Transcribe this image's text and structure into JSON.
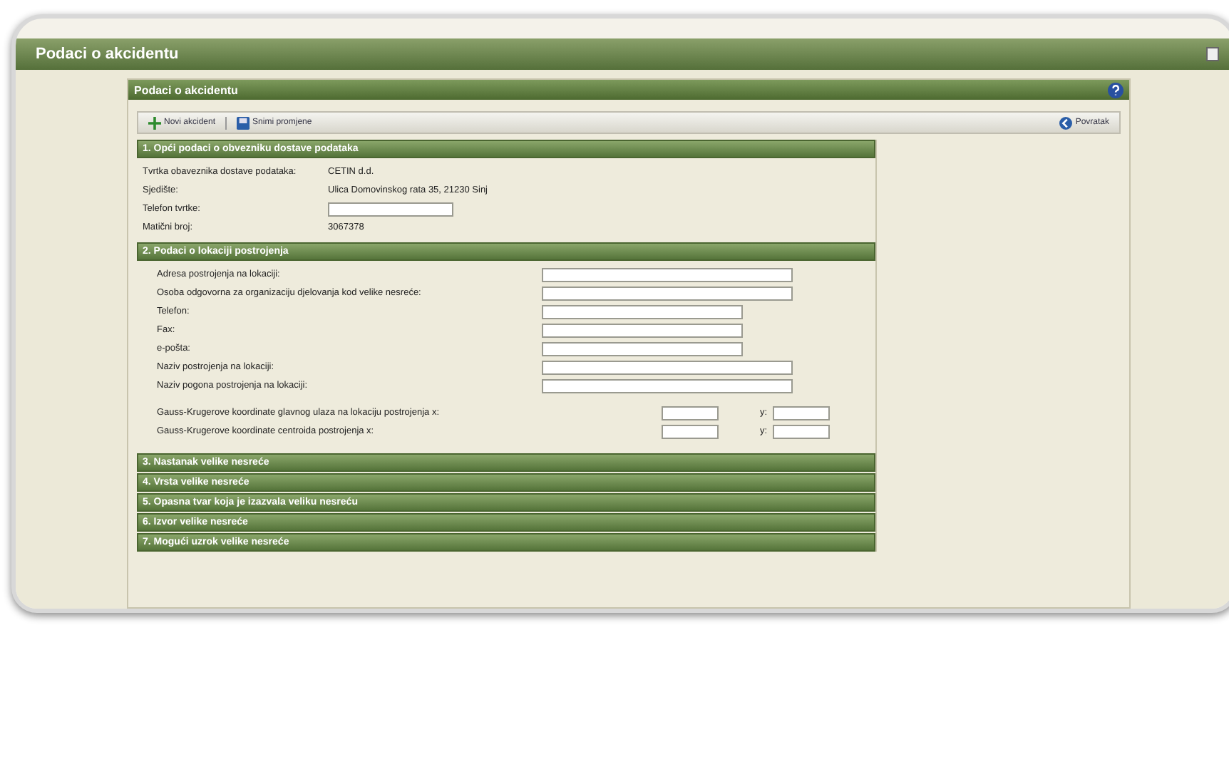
{
  "window": {
    "title": "Podaci o akcidentu"
  },
  "panel": {
    "title": "Podaci o akcidentu"
  },
  "toolbar": {
    "left": [
      {
        "label": "Novi akcident",
        "kind": "add"
      },
      {
        "label": "Snimi promjene",
        "kind": "save"
      }
    ],
    "right": {
      "label": "Povratak",
      "kind": "back"
    }
  },
  "section1": {
    "title": "1. Opći podaci o obvezniku dostave podataka",
    "rows": [
      {
        "label": "Tvrtka obaveznika dostave podataka:",
        "kind": "text",
        "value": "CETIN d.d."
      },
      {
        "label": "Sjedište:",
        "kind": "text",
        "value": "Ulica Domovinskog rata 35, 21230 Sinj"
      },
      {
        "label": "Telefon tvrtke:",
        "kind": "field"
      },
      {
        "label": "Matični broj:",
        "kind": "text",
        "value": "3067378"
      }
    ]
  },
  "section2": {
    "title": "2. Podaci o lokaciji postrojenja",
    "rows": [
      {
        "label": "Adresa postrojenja na lokaciji:",
        "kind": "wide"
      },
      {
        "label": "Osoba odgovorna za organizaciju djelovanja kod velike nesreće:",
        "kind": "wide"
      },
      {
        "label": "Telefon:",
        "kind": "short"
      },
      {
        "label": "Fax:",
        "kind": "short"
      },
      {
        "label": "e-pošta:",
        "kind": "short"
      },
      {
        "label": "Naziv postrojenja na lokaciji:",
        "kind": "wide"
      },
      {
        "label": "Naziv pogona postrojenja na lokaciji:",
        "kind": "wide"
      }
    ],
    "coords": [
      {
        "label": "Gauss-Krugerove koordinate glavnog ulaza na lokaciju postrojenja x:",
        "y_label": "y:"
      },
      {
        "label": "Gauss-Krugerove koordinate centroida postrojenja x:",
        "y_label": "y:"
      }
    ]
  },
  "collapsed_sections": [
    "3. Nastanak velike nesreće",
    "4. Vrsta velike nesreće",
    "5. Opasna tvar koja je izazvala veliku nesreću",
    "6. Izvor velike nesreće",
    "7. Mogući uzrok velike nesreće"
  ]
}
